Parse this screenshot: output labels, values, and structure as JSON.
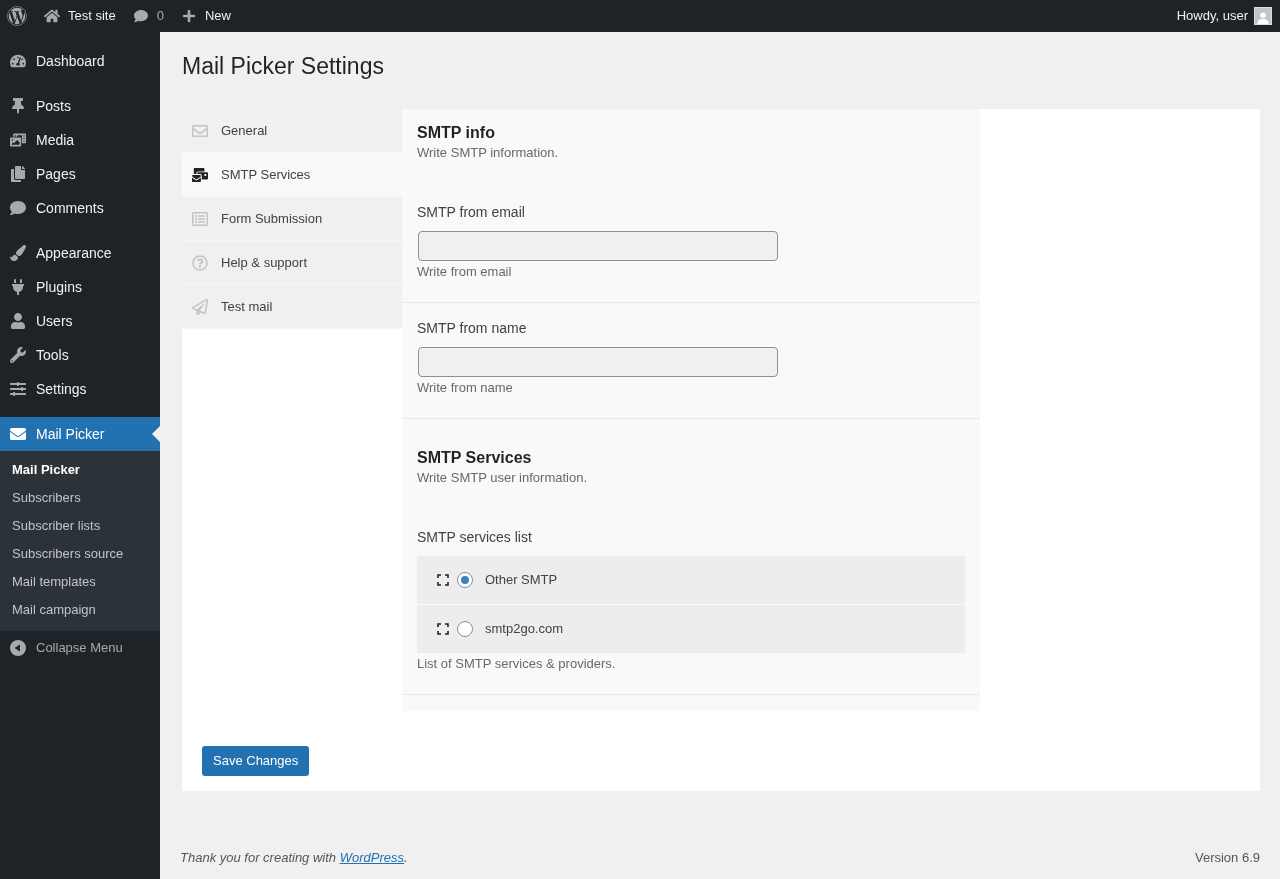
{
  "admin_bar": {
    "site_name": "Test site",
    "comments_count": "0",
    "new_label": "New",
    "greeting": "Howdy, user"
  },
  "sidebar": {
    "groups": [
      {
        "items": [
          {
            "label": "Dashboard",
            "selected": false
          }
        ]
      },
      {
        "items": [
          {
            "label": "Posts",
            "selected": false
          },
          {
            "label": "Media",
            "selected": false
          },
          {
            "label": "Pages",
            "selected": false
          },
          {
            "label": "Comments",
            "selected": false
          }
        ]
      },
      {
        "items": [
          {
            "label": "Appearance",
            "selected": false
          },
          {
            "label": "Plugins",
            "selected": false
          },
          {
            "label": "Users",
            "selected": false
          },
          {
            "label": "Tools",
            "selected": false
          },
          {
            "label": "Settings",
            "selected": false
          }
        ]
      },
      {
        "items": [
          {
            "label": "Mail Picker",
            "selected": true,
            "submenu": [
              {
                "label": "Mail Picker",
                "selected": true
              },
              {
                "label": "Subscribers",
                "selected": false
              },
              {
                "label": "Subscriber lists",
                "selected": false
              },
              {
                "label": "Subscribers source",
                "selected": false
              },
              {
                "label": "Mail templates",
                "selected": false
              },
              {
                "label": "Mail campaign",
                "selected": false
              }
            ]
          }
        ]
      }
    ],
    "collapse_label": "Collapse Menu"
  },
  "page": {
    "title": "Mail Picker Settings"
  },
  "tabs": [
    {
      "label": "General",
      "selected": false
    },
    {
      "label": "SMTP Services",
      "selected": true
    },
    {
      "label": "Form Submission",
      "selected": false
    },
    {
      "label": "Help & support",
      "selected": false
    },
    {
      "label": "Test mail",
      "selected": false
    }
  ],
  "sections": [
    {
      "title": "SMTP info",
      "description": "Write SMTP information.",
      "fields": [
        {
          "kind": "text",
          "label": "SMTP from email",
          "description": "Write from email"
        },
        {
          "kind": "text",
          "label": "SMTP from name",
          "description": "Write from name"
        }
      ]
    },
    {
      "title": "SMTP Services",
      "description": "Write SMTP user information.",
      "fields": [
        {
          "kind": "radio_list",
          "label": "SMTP services list",
          "options": [
            {
              "label": "Other SMTP",
              "selected": true
            },
            {
              "label": "smtp2go.com",
              "selected": false
            }
          ],
          "description": "List of SMTP services & providers."
        }
      ]
    }
  ],
  "save_button": "Save Changes",
  "footer": {
    "text": "Thank you for creating with ",
    "link": "WordPress",
    "text_after": ".",
    "version": "Version 6.9"
  }
}
